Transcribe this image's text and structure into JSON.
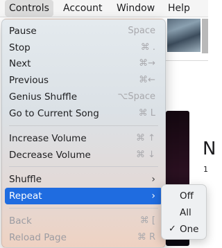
{
  "menubar": {
    "items": [
      {
        "label": "Controls",
        "active": true
      },
      {
        "label": "Account",
        "active": false
      },
      {
        "label": "Window",
        "active": false
      },
      {
        "label": "Help",
        "active": false
      }
    ]
  },
  "background": {
    "big_letter": "N",
    "small_digit": "1"
  },
  "controls_menu": {
    "items": [
      {
        "label": "Pause",
        "shortcut": "Space"
      },
      {
        "label": "Stop",
        "shortcut": "⌘ ."
      },
      {
        "label": "Next",
        "shortcut": "⌘→"
      },
      {
        "label": "Previous",
        "shortcut": "⌘←"
      },
      {
        "label": "Genius Shuffle",
        "shortcut": "⌥Space"
      },
      {
        "label": "Go to Current Song",
        "shortcut": "⌘ L"
      },
      {
        "label": "Increase Volume",
        "shortcut": "⌘ ↑"
      },
      {
        "label": "Decrease Volume",
        "shortcut": "⌘ ↓"
      },
      {
        "label": "Shuffle",
        "submenu": true
      },
      {
        "label": "Repeat",
        "submenu": true,
        "highlighted": true
      },
      {
        "label": "Back",
        "shortcut": "⌘ [",
        "disabled": true
      },
      {
        "label": "Reload Page",
        "shortcut": "⌘ R",
        "disabled": true
      }
    ],
    "submenu_arrow": "›"
  },
  "repeat_submenu": {
    "items": [
      {
        "label": "Off",
        "checked": false
      },
      {
        "label": "All",
        "checked": false
      },
      {
        "label": "One",
        "checked": true
      }
    ],
    "check_glyph": "✓"
  },
  "colors": {
    "highlight": "#1f6ce0",
    "shortcut_text": "#a8a8ac",
    "disabled_text": "#9c9ca2"
  }
}
